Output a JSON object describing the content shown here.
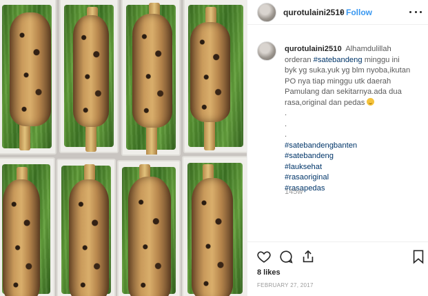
{
  "post": {
    "photo_alt": "Sate bandeng in trays on banana leaves"
  },
  "header": {
    "username": "qurotulaini2510",
    "separator": "•",
    "follow_label": "Follow",
    "more_icon": "more-horizontal-icon"
  },
  "caption": {
    "username": "qurotulaini2510",
    "lines": [
      "Alhamdulillah",
      "orderan",
      "#satebandeng",
      "minggu ini",
      "byk yg suka.yuk yg blm nyoba,ikutan",
      "PO nya tiap minggu utk daerah",
      "Pamulang dan sekitarnya.ada dua",
      "rasa,original dan pedas",
      ".",
      ".",
      "."
    ],
    "hashtags": [
      "#satebandengbanten",
      "#satebandeng",
      "#lauksehat",
      "#rasaoriginal",
      "#rasapedas"
    ],
    "time_ago": "145w"
  },
  "actions": {
    "icons": [
      "heart-icon",
      "comment-icon",
      "share-icon",
      "bookmark-icon"
    ],
    "likes": "8 likes",
    "date": "FEBRUARY 27, 2017"
  },
  "colors": {
    "accent": "#3897f0",
    "hashtag": "#003569",
    "muted": "#999999"
  }
}
